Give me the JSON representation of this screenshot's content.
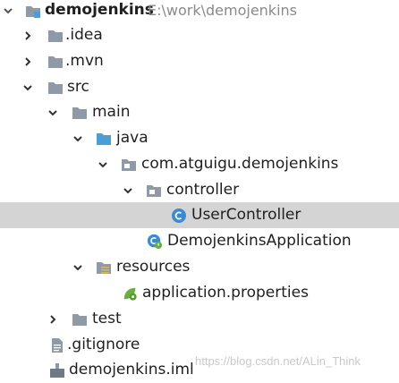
{
  "project": {
    "name": "demojenkins",
    "path": "E:\\work\\demojenkins"
  },
  "nodes": [
    {
      "label": ".idea",
      "icon": "folder-icon",
      "state": "collapsed"
    },
    {
      "label": ".mvn",
      "icon": "folder-icon",
      "state": "collapsed"
    },
    {
      "label": "src",
      "icon": "folder-icon",
      "state": "expanded"
    },
    {
      "label": "main",
      "icon": "folder-icon",
      "state": "expanded"
    },
    {
      "label": "java",
      "icon": "source-folder-icon",
      "state": "expanded"
    },
    {
      "label": "com.atguigu.demojenkins",
      "icon": "package-icon",
      "state": "expanded"
    },
    {
      "label": "controller",
      "icon": "package-icon",
      "state": "expanded"
    },
    {
      "label": "UserController",
      "icon": "class-icon",
      "state": "leaf",
      "selected": true
    },
    {
      "label": "DemojenkinsApplication",
      "icon": "spring-boot-class-icon",
      "state": "leaf"
    },
    {
      "label": "resources",
      "icon": "resources-folder-icon",
      "state": "expanded"
    },
    {
      "label": "application.properties",
      "icon": "spring-properties-icon",
      "state": "leaf"
    },
    {
      "label": "test",
      "icon": "folder-icon",
      "state": "collapsed"
    },
    {
      "label": ".gitignore",
      "icon": "text-file-icon",
      "state": "leaf"
    },
    {
      "label": "demojenkins.iml",
      "icon": "module-file-icon",
      "state": "leaf"
    }
  ],
  "watermark": "https://blog.csdn.net/ALin_Think",
  "colors": {
    "folder": "#8f9aa6",
    "source_folder": "#4a9dd6",
    "class": "#3a8ad1",
    "spring": "#6aae3f",
    "selection": "#d4d4d4"
  }
}
